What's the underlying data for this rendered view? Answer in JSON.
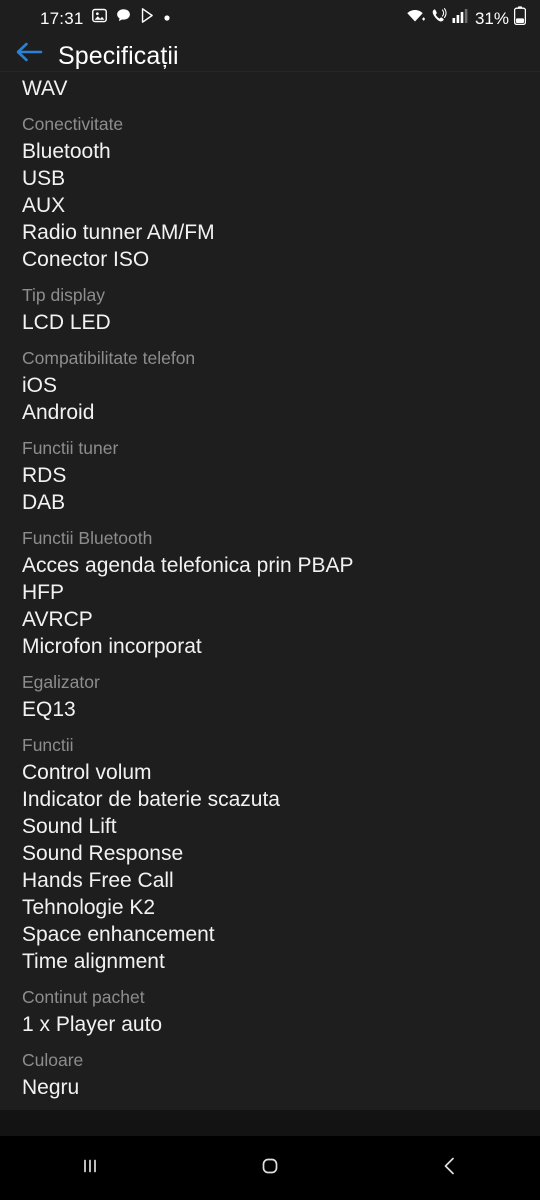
{
  "status_bar": {
    "time": "17:31",
    "battery_percent": "31%",
    "left_icons": [
      "gallery-icon",
      "chat-bubble-icon",
      "play-store-icon",
      "dot-icon"
    ],
    "right_icons": [
      "wifi-icon",
      "call-sound-icon",
      "signal-bars-icon",
      "battery-icon"
    ]
  },
  "app_bar": {
    "back_icon": "back-arrow-icon",
    "title": "Specificații",
    "accent_color": "#2b82d4"
  },
  "content": {
    "partial_top_item": "WAV",
    "groups": [
      {
        "header": "Conectivitate",
        "items": [
          "Bluetooth",
          "USB",
          "AUX",
          "Radio tunner AM/FM",
          "Conector ISO"
        ]
      },
      {
        "header": "Tip display",
        "items": [
          "LCD LED"
        ]
      },
      {
        "header": "Compatibilitate telefon",
        "items": [
          "iOS",
          "Android"
        ]
      },
      {
        "header": "Functii tuner",
        "items": [
          "RDS",
          "DAB"
        ]
      },
      {
        "header": "Functii Bluetooth",
        "items": [
          "Acces agenda telefonica prin PBAP",
          "HFP",
          "AVRCP",
          "Microfon incorporat"
        ]
      },
      {
        "header": "Egalizator",
        "items": [
          "EQ13"
        ]
      },
      {
        "header": "Functii",
        "items": [
          "Control volum",
          "Indicator de baterie scazuta",
          "Sound Lift",
          "Sound Response",
          "Hands Free Call",
          "Tehnologie K2",
          "Space enhancement",
          "Time alignment"
        ]
      },
      {
        "header": "Continut pachet",
        "items": [
          "1 x Player auto"
        ]
      },
      {
        "header": "Culoare",
        "items": [
          "Negru"
        ]
      }
    ]
  },
  "nav_bar": {
    "recents_icon": "recents-icon",
    "home_icon": "home-icon",
    "back_icon": "back-chevron-icon"
  }
}
